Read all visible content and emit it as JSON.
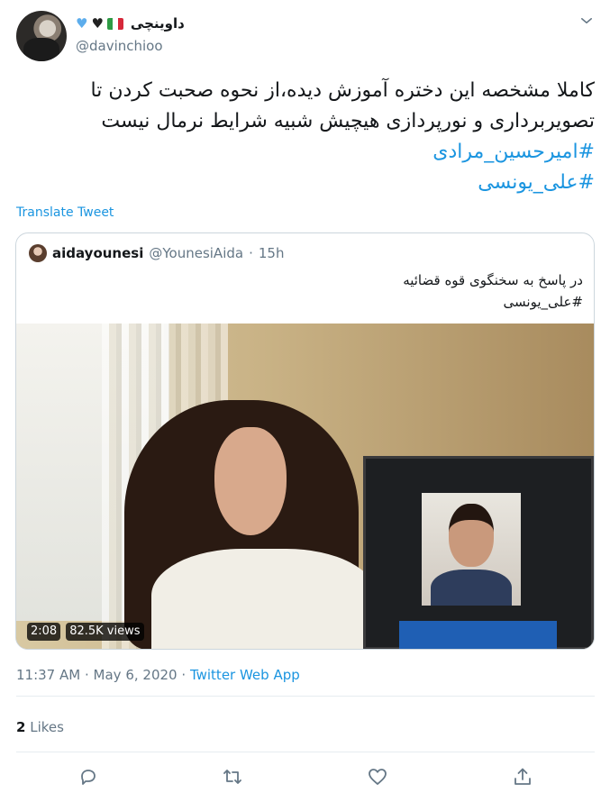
{
  "author": {
    "display_name": "داوینچی",
    "handle": "@davinchioo",
    "badges": [
      "blue-heart",
      "black-heart",
      "italy-flag"
    ]
  },
  "tweet": {
    "lines": [
      "کاملا مشخصه این دختره آموزش دیده،از نحوه صحبت کردن تا",
      "تصویربرداری و نورپردازی هیچیش شبیه شرایط نرمال نیست"
    ],
    "hashtags": [
      "#امیرحسین_مرادی",
      "#علی_یونسی"
    ],
    "translate_label": "Translate Tweet"
  },
  "quoted": {
    "name": "aidayounesi",
    "handle": "@YounesiAida",
    "separator": "·",
    "time": "15h",
    "text": "در پاسخ به سخنگوی قوه قضائیه",
    "hashtag": "#علی_یونسی",
    "video": {
      "duration": "2:08",
      "views": "82.5K views"
    }
  },
  "meta": {
    "time": "11:37 AM",
    "dot1": "·",
    "date": "May 6, 2020",
    "dot2": "·",
    "source": "Twitter Web App"
  },
  "stats": {
    "likes_count": "2",
    "likes_label": "Likes"
  },
  "actions": [
    "reply-icon",
    "retweet-icon",
    "like-icon",
    "share-icon"
  ],
  "colors": {
    "link": "#1b95e0",
    "secondary_text": "#657786",
    "border": "#ccd6dd"
  }
}
